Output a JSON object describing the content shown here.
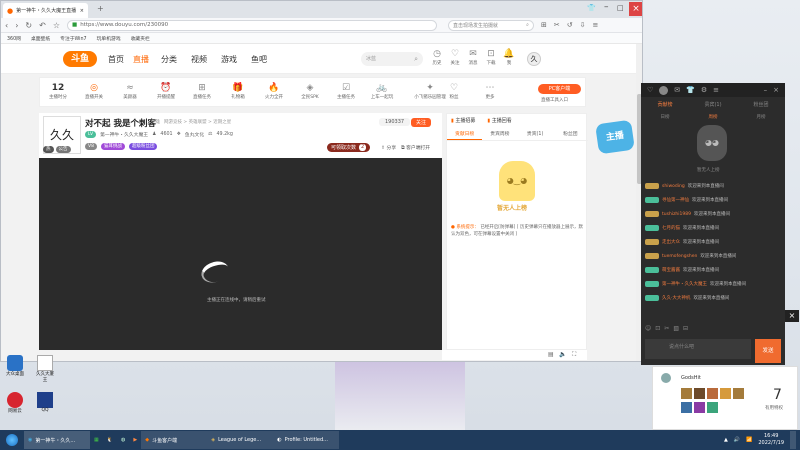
{
  "browser": {
    "tab_title": "第一神牛・久久大魔王直播",
    "url": "https://www.douyu.com/230090",
    "search_placeholder": "直击现场发生拍摄就",
    "bookmarks": [
      "360网",
      "桌面壁纸",
      "专注于Win7",
      "玩单机游戏",
      "收藏夹栏"
    ]
  },
  "douyu": {
    "logo": "斗鱼",
    "nav": [
      "首页",
      "直播",
      "分类",
      "视频",
      "游戏",
      "鱼吧"
    ],
    "search_placeholder": "冰蓝",
    "header_icons": [
      "历史",
      "关注",
      "消息",
      "下载",
      "我"
    ],
    "toolbar": [
      {
        "icon": "12",
        "label": "主播时分"
      },
      {
        "icon": "◎",
        "label": "直播开关"
      },
      {
        "icon": "≈",
        "label": "美颜器"
      },
      {
        "icon": "⏰",
        "label": "开播提醒"
      },
      {
        "icon": "⊞",
        "label": "直播任务"
      },
      {
        "icon": "🎁",
        "label": "礼物箱"
      },
      {
        "icon": "🔥",
        "label": "火力全开"
      },
      {
        "icon": "◈",
        "label": "全民SPK"
      },
      {
        "icon": "☑",
        "label": "主播任务"
      },
      {
        "icon": "🚲",
        "label": "上车一起玩"
      },
      {
        "icon": "✦",
        "label": "小飞猪乐园管理"
      },
      {
        "icon": "♡",
        "label": "粉丝"
      },
      {
        "icon": "⋯",
        "label": "更多"
      }
    ],
    "pc_button": "PC客户端",
    "pc_sub": "直播工具入口"
  },
  "room": {
    "title": "对不起 我是个刺客",
    "category": "英雄",
    "tags": "网游竞技 > 英雄联盟 > 近期之星",
    "anchor": "第一神牛・久久大魔王",
    "fans": "4601",
    "group": "鱼丸文化",
    "weight": "49.2kg",
    "follow_count": "190337",
    "follow_label": "关注",
    "level_badge": "V8",
    "hot_badge": "猫耳挑战",
    "rank_badge": "超级粉丝团",
    "lottery": "可领取次数",
    "lottery_count": "2",
    "share": "分享",
    "client": "客户端打开",
    "side_badge_1": "热",
    "side_badge_2": "公告",
    "video_hint": "主播正在连线中，请稍后重试"
  },
  "rank": {
    "tabs": [
      "贡献日榜",
      "贵宾周榜",
      "贵宾(1)",
      "粉丝团"
    ],
    "top_tabs": [
      "主播招募",
      "主播回看"
    ],
    "empty": "暂无人上榜",
    "notice_label": "系统提示：",
    "notice_text": "已经开启[防弹幕] [ 历史弹幕只在播放器上展示，默认为双色，可在弹幕设置中关闭 ]"
  },
  "chat": {
    "tabs": [
      "贡献榜",
      "贵宾(1)",
      "粉丝团"
    ],
    "sub_tabs": [
      "日榜",
      "周榜",
      "月榜"
    ],
    "empty": "暂无人上榜",
    "messages": [
      {
        "name": "shiwoding",
        "text": "欢迎来到本直播间"
      },
      {
        "name": "寻仙第一神仙",
        "text": "欢迎来到本直播间"
      },
      {
        "name": "tushizhi1989",
        "text": "欢迎来到本直播间"
      },
      {
        "name": "七月的猫",
        "text": "欢迎来到本直播间"
      },
      {
        "name": "走出大众",
        "text": "欢迎来到本直播间"
      },
      {
        "name": "tuemofengshen",
        "text": "欢迎来到本直播间"
      },
      {
        "name": "萌宝酱酱",
        "text": "欢迎来到本直播间"
      },
      {
        "name": "第一神牛・久久大魔王",
        "text": "欢迎来到本直播间"
      },
      {
        "name": "久久·大大神机",
        "text": "欢迎来到本直播间"
      }
    ],
    "input_placeholder": "说点什么吧",
    "send": "发送",
    "user": "GodsHit",
    "level": "7",
    "level_label": "有用特权"
  },
  "desktop": {
    "icons": [
      "大众桌面",
      "久久大厦王",
      "网易云",
      "QQ"
    ]
  },
  "taskbar": {
    "items": [
      "第一神牛・久久...",
      "",
      "",
      "",
      "",
      "斗鱼客户端",
      "League of Lege...",
      "Profile: Untitled..."
    ],
    "clock": "16:49",
    "date": "2022/7/19"
  }
}
